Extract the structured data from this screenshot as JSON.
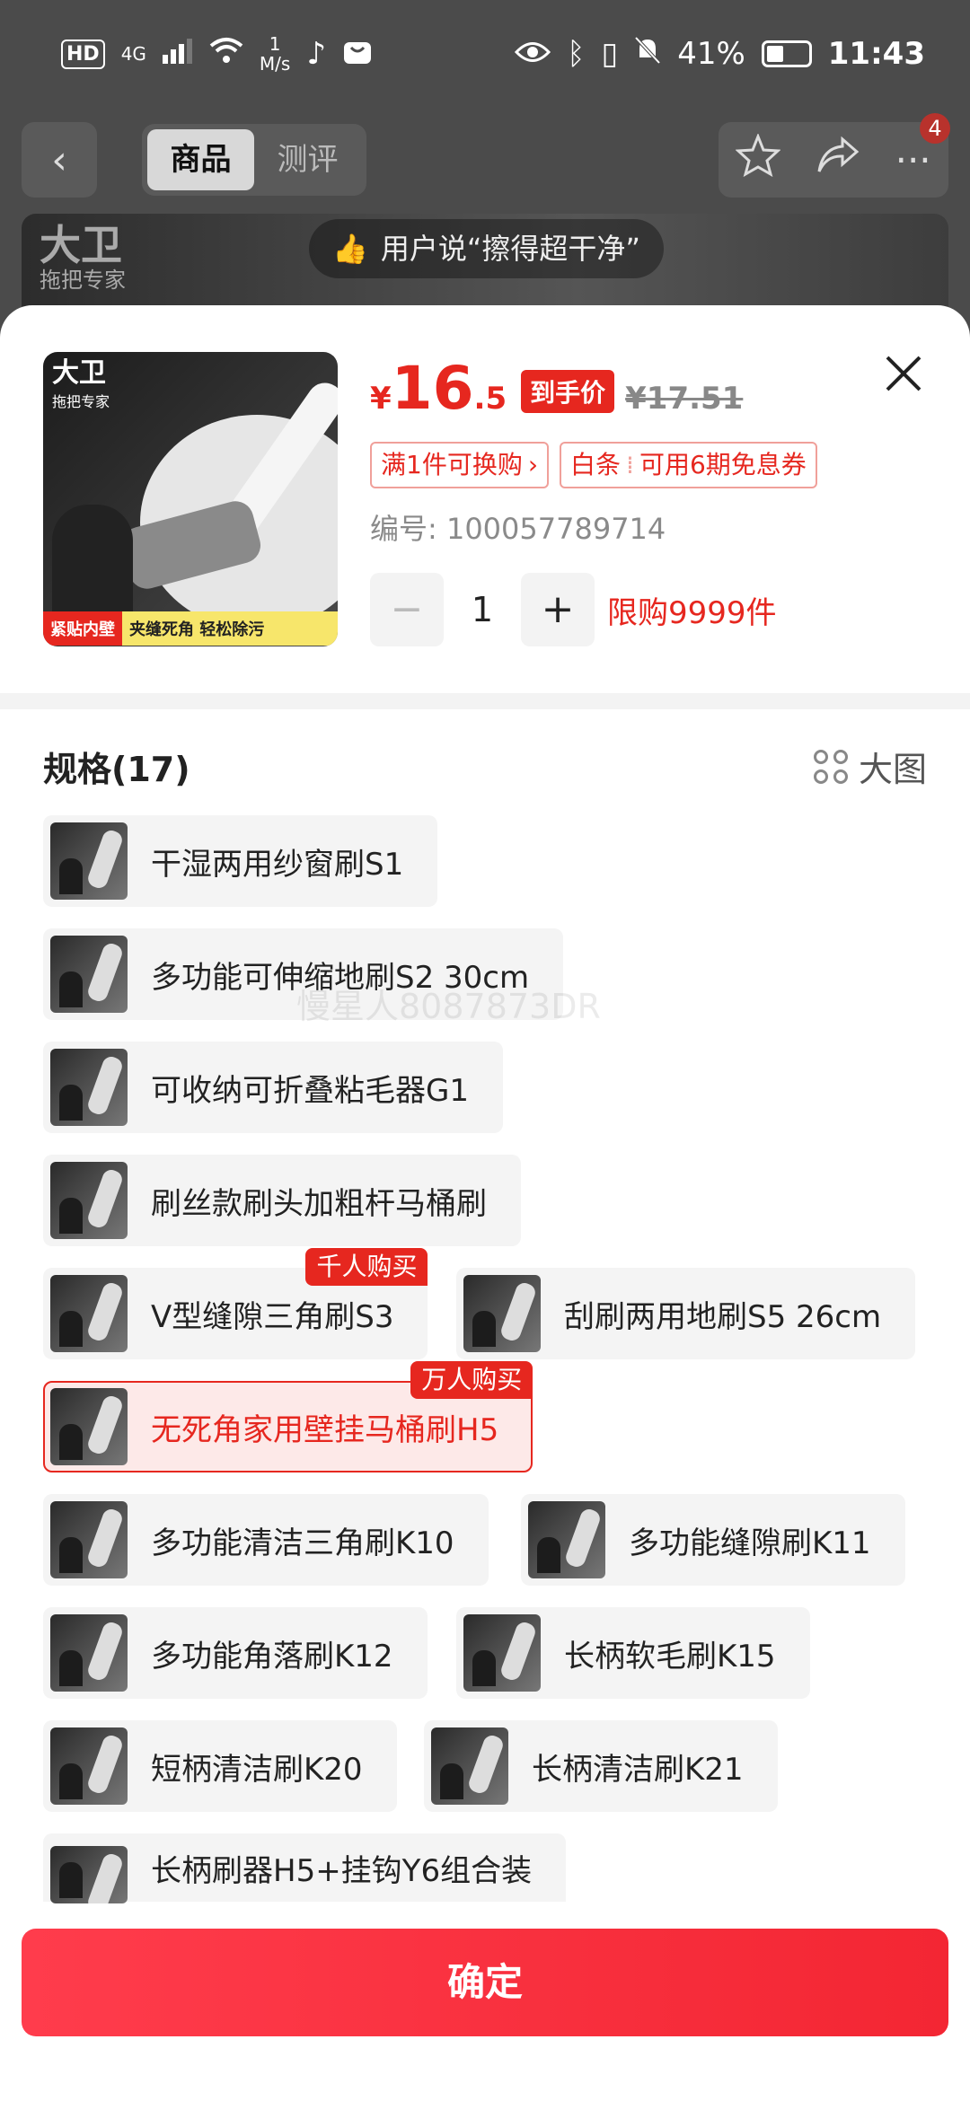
{
  "status_bar": {
    "hd": "HD",
    "network": "4G",
    "speed_value": "1",
    "speed_unit": "M/s",
    "battery_pct": "41%",
    "battery_level": 0.41,
    "time": "11:43"
  },
  "background_page": {
    "tabs": [
      "商品",
      "测评"
    ],
    "active_tab": 0,
    "cart_badge": "4",
    "banner_text": "用户说“擦得超干净”",
    "brand_name": "大卫",
    "brand_sub": "拖把专家"
  },
  "product": {
    "currency": "¥",
    "price_int": "16",
    "price_dec": ".5",
    "price_tag": "到手价",
    "old_price": "¥17.51",
    "coupons": [
      {
        "text": "满1件可换购",
        "arrow": "›"
      },
      {
        "prefix": "白条",
        "text": "可用6期免息券"
      }
    ],
    "sku_label": "编号: 100057789714",
    "quantity": "1",
    "limit": "限购9999件",
    "thumb_logo": "大卫",
    "thumb_logo_sub": "拖把专家",
    "thumb_bar_left": "紧贴内壁",
    "thumb_bar_right": "夹缝死角 轻松除污"
  },
  "spec": {
    "title": "规格(17)",
    "big_image_label": "大图",
    "options": [
      {
        "label": "干湿两用纱窗刷S1"
      },
      {
        "label": "多功能可伸缩地刷S2 30cm"
      },
      {
        "label": "可收纳可折叠粘毛器G1"
      },
      {
        "label": "刷丝款刷头加粗杆马桶刷"
      },
      {
        "label": "V型缝隙三角刷S3",
        "tag": "千人购买"
      },
      {
        "label": "刮刷两用地刷S5 26cm"
      },
      {
        "label": "无死角家用壁挂马桶刷H5",
        "tag": "万人购买",
        "selected": true
      },
      {
        "label": "多功能清洁三角刷K10"
      },
      {
        "label": "多功能缝隙刷K11"
      },
      {
        "label": "多功能角落刷K12"
      },
      {
        "label": "长柄软毛刷K15"
      },
      {
        "label": "短柄清洁刷K20"
      },
      {
        "label": "长柄清洁刷K21"
      },
      {
        "label": "长柄刷器H5+挂钩Y6组合装"
      }
    ]
  },
  "watermark": "慢星人8087873DR",
  "confirm_label": "确定",
  "colors": {
    "accent": "#e6271f",
    "confirm_gradient": [
      "#ff3c4c",
      "#f32633"
    ]
  }
}
